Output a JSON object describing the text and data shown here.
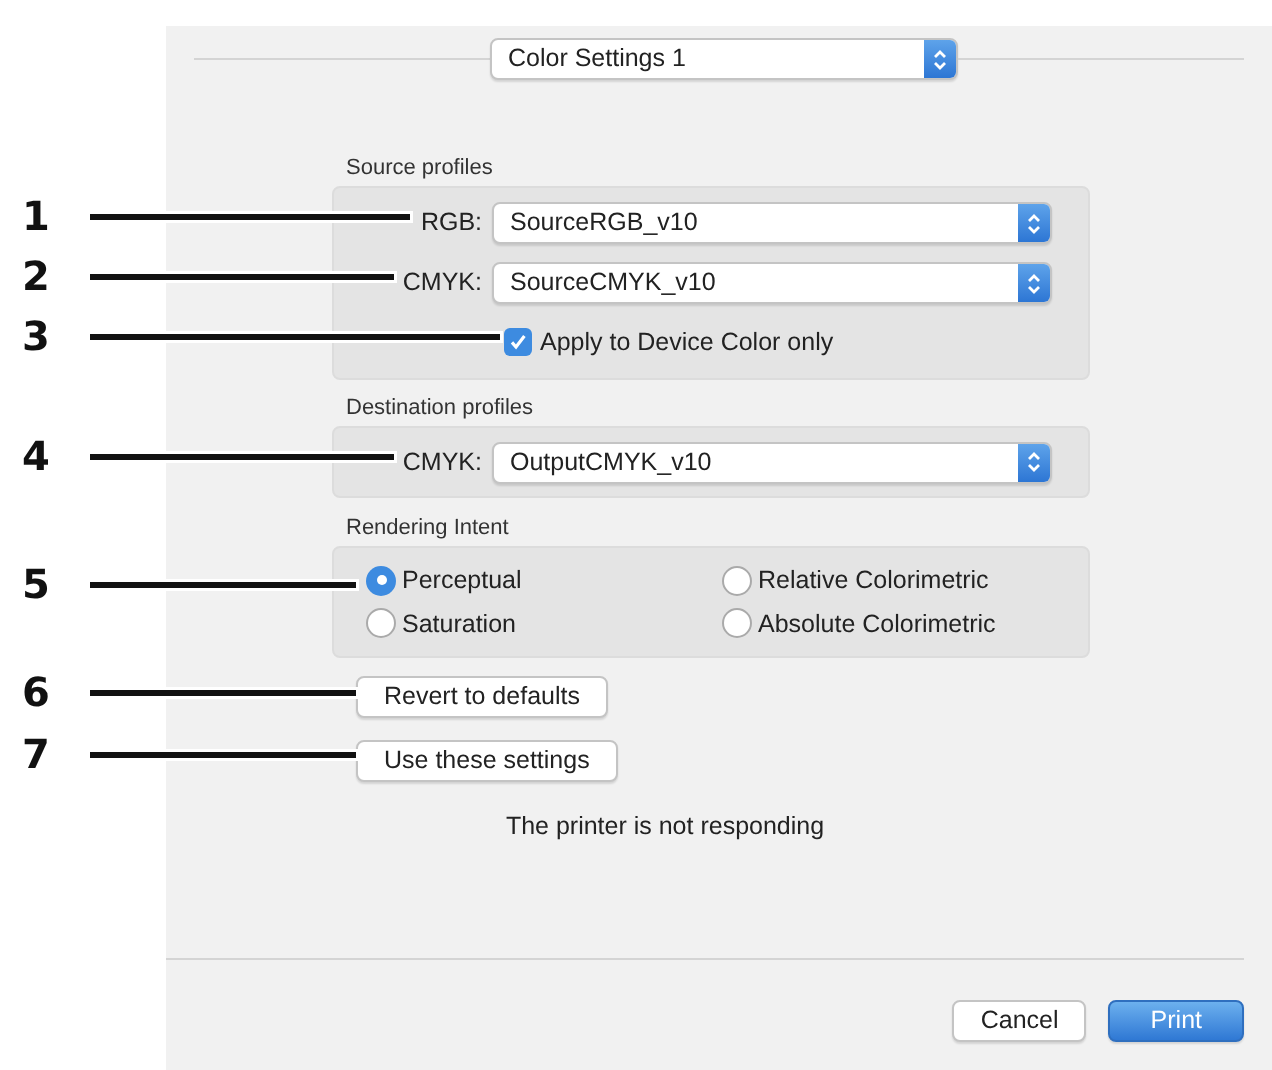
{
  "header_popup": {
    "value": "Color Settings 1"
  },
  "source_profiles": {
    "title": "Source profiles",
    "fields": [
      {
        "label": "RGB:",
        "value": "SourceRGB_v10"
      },
      {
        "label": "CMYK:",
        "value": "SourceCMYK_v10"
      }
    ],
    "checkbox": {
      "label": "Apply to Device Color only",
      "checked": true
    }
  },
  "destination_profiles": {
    "title": "Destination profiles",
    "fields": [
      {
        "label": "CMYK:",
        "value": "OutputCMYK_v10"
      }
    ]
  },
  "rendering_intent": {
    "title": "Rendering Intent",
    "options": [
      {
        "label": "Perceptual",
        "selected": true
      },
      {
        "label": "Relative Colorimetric",
        "selected": false
      },
      {
        "label": "Saturation",
        "selected": false
      },
      {
        "label": "Absolute Colorimetric",
        "selected": false
      }
    ]
  },
  "buttons": [
    {
      "label": "Revert to defaults"
    },
    {
      "label": "Use these settings"
    }
  ],
  "status_message": "The printer is not responding",
  "footer_buttons": [
    {
      "label": "Cancel",
      "kind": "default"
    },
    {
      "label": "Print",
      "kind": "primary"
    }
  ],
  "callouts": [
    "1",
    "2",
    "3",
    "4",
    "5",
    "6",
    "7"
  ]
}
